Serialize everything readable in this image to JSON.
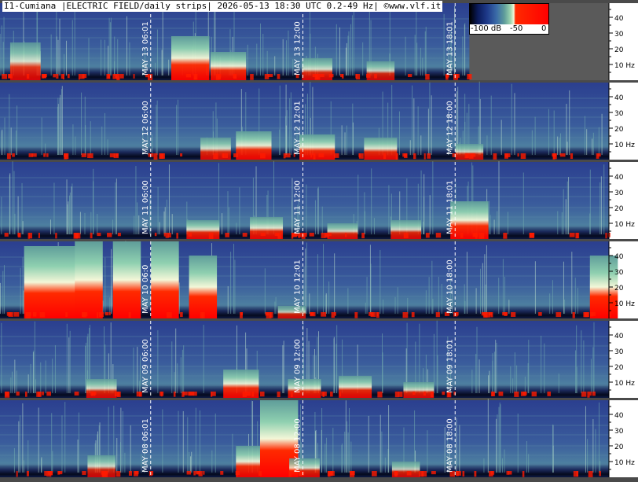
{
  "header": {
    "title": "I1-Cumiana |ELECTRIC FIELD/daily strips| 2026-05-13 18:30 UTC 0.2-49 Hz| ©www.vlf.it"
  },
  "colorbar": {
    "label_min": "-100 dB",
    "label_mid": "-50",
    "label_max": "0",
    "colors": [
      "#000000",
      "#1e3a8a",
      "#5f9d9a",
      "#f3f7d8",
      "#ff0000"
    ]
  },
  "chart_data": {
    "type": "heatmap",
    "title": "I1-Cumiana |ELECTRIC FIELD/daily strips| 2026-05-13 18:30 UTC 0.2-49 Hz| ©www.vlf.it",
    "y_ticks": [
      "40",
      "30",
      "20",
      "10 Hz"
    ],
    "y_tick_values": [
      40,
      30,
      20,
      10
    ],
    "ylim": [
      0.2,
      49
    ],
    "xlim_hours": [
      0,
      24
    ],
    "time_markers_hours": [
      6,
      12,
      18
    ],
    "strips": [
      {
        "day": "MAY 13",
        "markers": [
          "MAY 13  06:01",
          "MAY 13  12:00",
          "MAY 13  18:01"
        ],
        "data_until_hour": 18.5,
        "bursts": [
          [
            1.0,
            24,
            0.6
          ],
          [
            7.5,
            28,
            0.9
          ],
          [
            9.0,
            18,
            0.8
          ],
          [
            12.5,
            14,
            0.6
          ],
          [
            15.0,
            12,
            0.5
          ]
        ]
      },
      {
        "day": "MAY 12",
        "markers": [
          "MAY 12  06:00",
          "MAY 12  12:01",
          "MAY 12  18:00"
        ],
        "data_until_hour": 24,
        "bursts": [
          [
            8.5,
            14,
            0.6
          ],
          [
            10.0,
            18,
            0.8
          ],
          [
            12.5,
            16,
            0.8
          ],
          [
            15.0,
            14,
            0.7
          ],
          [
            18.5,
            10,
            0.5
          ]
        ]
      },
      {
        "day": "MAY 11",
        "markers": [
          "MAY 11  06:00",
          "MAY 11  12:00",
          "MAY 11  18:01"
        ],
        "data_until_hour": 24,
        "bursts": [
          [
            8.0,
            12,
            0.7
          ],
          [
            10.5,
            14,
            0.7
          ],
          [
            13.5,
            10,
            0.6
          ],
          [
            16.0,
            12,
            0.6
          ],
          [
            18.5,
            24,
            0.9
          ]
        ]
      },
      {
        "day": "MAY 10",
        "markers": [
          "MAY 10  06:0",
          "MAY 10  12:01",
          "MAY 10  18:00"
        ],
        "data_until_hour": 24,
        "bursts": [
          [
            1.5,
            46,
            1.0
          ],
          [
            2.5,
            46,
            1.0
          ],
          [
            3.5,
            49,
            1.0
          ],
          [
            5.0,
            49,
            1.0
          ],
          [
            6.5,
            49,
            1.0
          ],
          [
            8.0,
            40,
            1.0
          ],
          [
            11.5,
            8,
            0.5
          ],
          [
            23.8,
            40,
            1.0
          ]
        ]
      },
      {
        "day": "MAY 09",
        "markers": [
          "MAY 09  06:00",
          "MAY 09  12:00",
          "MAY 09  18:01"
        ],
        "data_until_hour": 24,
        "bursts": [
          [
            4.0,
            12,
            0.6
          ],
          [
            9.5,
            18,
            0.8
          ],
          [
            12.0,
            12,
            0.7
          ],
          [
            14.0,
            14,
            0.7
          ],
          [
            16.5,
            10,
            0.6
          ]
        ]
      },
      {
        "day": "MAY 08",
        "markers": [
          "MAY 08  06:01",
          "MAY 08  12:00",
          "MAY 08  18:00"
        ],
        "data_until_hour": 24,
        "bursts": [
          [
            4.0,
            14,
            0.5
          ],
          [
            10.0,
            20,
            0.8
          ],
          [
            10.8,
            49,
            1.0
          ],
          [
            11.2,
            49,
            1.0
          ],
          [
            12.0,
            12,
            0.6
          ],
          [
            16.0,
            10,
            0.5
          ]
        ]
      }
    ]
  }
}
